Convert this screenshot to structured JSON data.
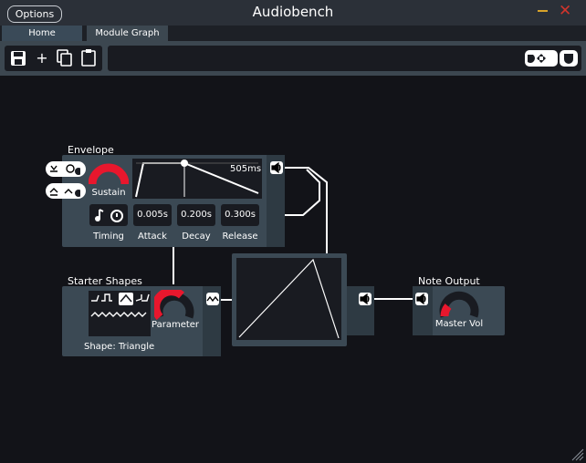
{
  "window": {
    "title": "Audiobench",
    "options_label": "Options",
    "minimize_glyph": "—",
    "close_glyph": "✕"
  },
  "tabs": [
    {
      "label": "Home"
    },
    {
      "label": "Module Graph"
    }
  ],
  "toolbar": {
    "save_icon": "save-icon",
    "add_glyph": "+",
    "copy_icon": "copy-icon",
    "paste_icon": "paste-icon"
  },
  "modules": {
    "envelope": {
      "title": "Envelope",
      "knob_label": "Sustain",
      "graph_time": "505ms",
      "timing_label": "Timing",
      "attack_value": "0.005s",
      "attack_label": "Attack",
      "decay_value": "0.200s",
      "decay_label": "Decay",
      "release_value": "0.300s",
      "release_label": "Release"
    },
    "starter_shapes": {
      "title": "Starter Shapes",
      "knob_label": "Parameter",
      "shape_label": "Shape: Triangle"
    },
    "note_output": {
      "title": "Note Output",
      "knob_label": "Master Vol"
    }
  },
  "colors": {
    "accent_red": "#e8172d",
    "module_bg": "#3b4954",
    "canvas_bg": "#121318",
    "titlebar_bg": "#2b3038"
  }
}
